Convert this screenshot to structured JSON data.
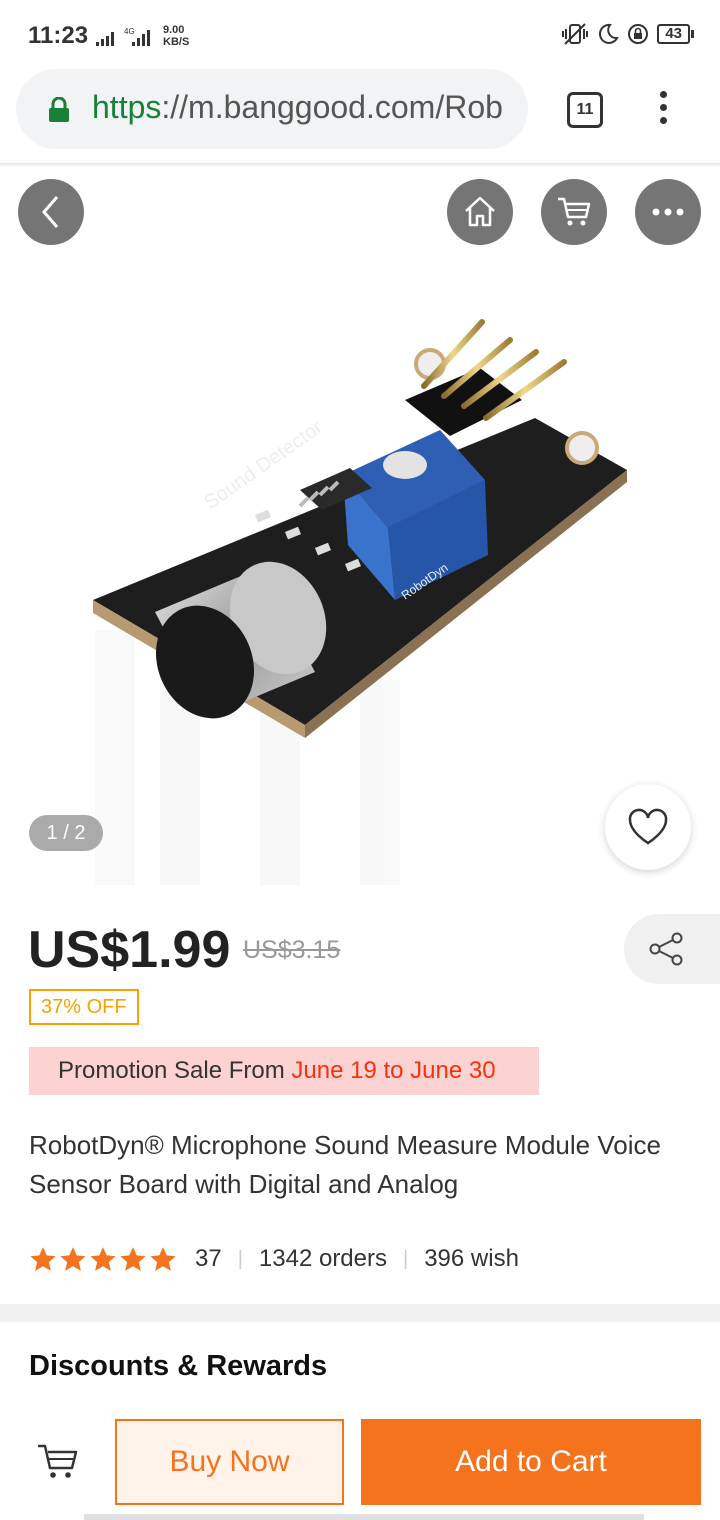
{
  "status_bar": {
    "time": "11:23",
    "net_label": "4G",
    "speed_value": "9.00",
    "speed_unit": "KB/S",
    "battery": "43"
  },
  "browser": {
    "url_scheme": "https",
    "url_rest": "://m.banggood.com/Rob",
    "tab_count": "11",
    "accent_secure": "#188038"
  },
  "overlay_icons": {
    "back": "chevron-left-icon",
    "home": "home-icon",
    "cart": "cart-icon",
    "more": "more-icon"
  },
  "gallery": {
    "pager": "1 / 2",
    "board_label": "Sound Detector",
    "brand_small": "RobotDyn"
  },
  "product": {
    "price": "US$1.99",
    "old_price": "US$3.15",
    "discount": "37% OFF",
    "promo_prefix": "Promotion Sale From ",
    "promo_dates": "June 19 to June 30",
    "title": "RobotDyn® Microphone Sound Measure Module Voice Sensor Board with Digital and Analog",
    "rating_stars": 5,
    "reviews": "37",
    "orders": "1342 orders",
    "wish": "396 wish"
  },
  "sections": {
    "discounts_title": "Discounts & Rewards"
  },
  "actions": {
    "buy_now": "Buy Now",
    "add_to_cart": "Add to Cart"
  },
  "colors": {
    "accent_orange": "#f5731c",
    "star": "#f5731c",
    "promo_bg": "#fdd2d2",
    "promo_red": "#f2330d",
    "off_badge": "#f4a300"
  }
}
